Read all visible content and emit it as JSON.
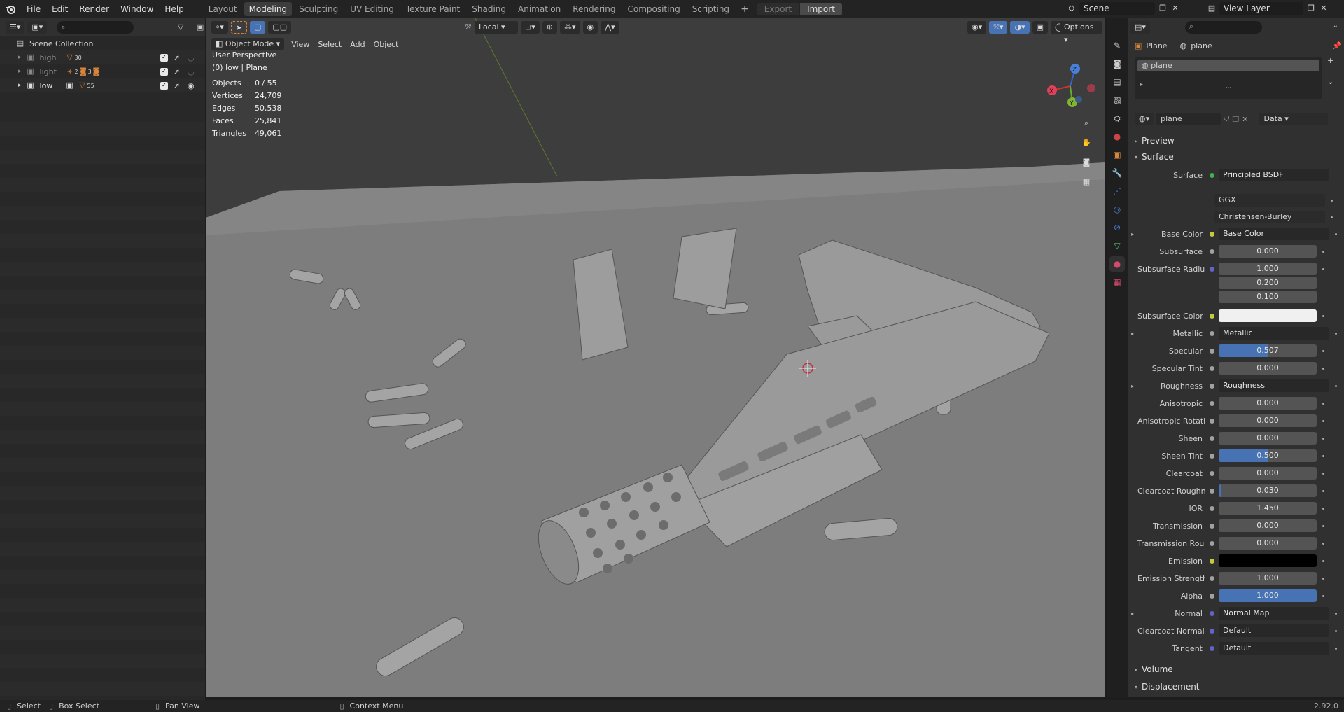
{
  "menu": [
    "File",
    "Edit",
    "Render",
    "Window",
    "Help"
  ],
  "workspaces": [
    "Layout",
    "Modeling",
    "Sculpting",
    "UV Editing",
    "Texture Paint",
    "Shading",
    "Animation",
    "Rendering",
    "Compositing",
    "Scripting"
  ],
  "active_workspace": "Modeling",
  "export_label": "Export",
  "import_label": "Import",
  "scene": "Scene",
  "view_layer": "View Layer",
  "outliner": {
    "title": "Scene Collection",
    "items": [
      {
        "name": "high",
        "badge": "30"
      },
      {
        "name": "light",
        "badge": "2",
        "badge2": "3"
      },
      {
        "name": "low",
        "badge": "55"
      }
    ]
  },
  "viewport": {
    "mode": "Object Mode",
    "menus": [
      "View",
      "Select",
      "Add",
      "Object"
    ],
    "orientation": "Local",
    "options": "Options",
    "perspective": "User Perspective",
    "context": "(0) low | Plane",
    "stats": [
      {
        "label": "Objects",
        "value": "0 / 55"
      },
      {
        "label": "Vertices",
        "value": "24,709"
      },
      {
        "label": "Edges",
        "value": "50,538"
      },
      {
        "label": "Faces",
        "value": "25,841"
      },
      {
        "label": "Triangles",
        "value": "49,061"
      }
    ],
    "gizmo": {
      "x": "X",
      "y": "Y",
      "z": "Z"
    }
  },
  "properties": {
    "object": "Plane",
    "material": "plane",
    "slot": "plane",
    "mat_field": "plane",
    "link": "Data",
    "panels": {
      "preview": "Preview",
      "surface": "Surface",
      "volume": "Volume",
      "displacement": "Displacement"
    },
    "surface_label": "Surface",
    "surface_value": "Principled BSDF",
    "distribution": "GGX",
    "subsurface_method": "Christensen-Burley",
    "rows": [
      {
        "label": "Base Color",
        "value": "Base Color",
        "kind": "link",
        "sock": "#c8c83a",
        "expand": true
      },
      {
        "label": "Subsurface",
        "value": "0.000",
        "kind": "num",
        "sock": "#a1a1a1"
      },
      {
        "label": "Subsurface Radius",
        "value": "1.000",
        "kind": "num",
        "sock": "#6363c7"
      },
      {
        "label": "",
        "value": "0.200",
        "kind": "num",
        "sock": ""
      },
      {
        "label": "",
        "value": "0.100",
        "kind": "num",
        "sock": ""
      },
      {
        "label": "Subsurface Color",
        "value": "",
        "kind": "color",
        "color": "#f0f0f0",
        "sock": "#c8c83a"
      },
      {
        "label": "Metallic",
        "value": "Metallic",
        "kind": "link",
        "sock": "#a1a1a1",
        "expand": true
      },
      {
        "label": "Specular",
        "value": "0.507",
        "kind": "slider",
        "fill": 0.507,
        "sock": "#a1a1a1"
      },
      {
        "label": "Specular Tint",
        "value": "0.000",
        "kind": "num",
        "sock": "#a1a1a1"
      },
      {
        "label": "Roughness",
        "value": "Roughness",
        "kind": "link",
        "sock": "#a1a1a1",
        "expand": true
      },
      {
        "label": "Anisotropic",
        "value": "0.000",
        "kind": "num",
        "sock": "#a1a1a1"
      },
      {
        "label": "Anisotropic Rotation",
        "value": "0.000",
        "kind": "num",
        "sock": "#a1a1a1"
      },
      {
        "label": "Sheen",
        "value": "0.000",
        "kind": "num",
        "sock": "#a1a1a1"
      },
      {
        "label": "Sheen Tint",
        "value": "0.500",
        "kind": "slider",
        "fill": 0.5,
        "sock": "#a1a1a1"
      },
      {
        "label": "Clearcoat",
        "value": "0.000",
        "kind": "num",
        "sock": "#a1a1a1"
      },
      {
        "label": "Clearcoat Roughness",
        "value": "0.030",
        "kind": "slider",
        "fill": 0.03,
        "sock": "#a1a1a1"
      },
      {
        "label": "IOR",
        "value": "1.450",
        "kind": "num",
        "sock": "#a1a1a1"
      },
      {
        "label": "Transmission",
        "value": "0.000",
        "kind": "num",
        "sock": "#a1a1a1"
      },
      {
        "label": "Transmission Rough...",
        "value": "0.000",
        "kind": "num",
        "sock": "#a1a1a1"
      },
      {
        "label": "Emission",
        "value": "",
        "kind": "color",
        "color": "#000000",
        "sock": "#c8c83a"
      },
      {
        "label": "Emission Strength",
        "value": "1.000",
        "kind": "num",
        "sock": "#a1a1a1"
      },
      {
        "label": "Alpha",
        "value": "1.000",
        "kind": "slider",
        "fill": 1.0,
        "sock": "#a1a1a1"
      },
      {
        "label": "Normal",
        "value": "Normal Map",
        "kind": "link",
        "sock": "#6363c7",
        "expand": true
      },
      {
        "label": "Clearcoat Normal",
        "value": "Default",
        "kind": "link",
        "sock": "#6363c7"
      },
      {
        "label": "Tangent",
        "value": "Default",
        "kind": "link",
        "sock": "#6363c7"
      }
    ]
  },
  "status": {
    "select": "Select",
    "box_select": "Box Select",
    "pan_view": "Pan View",
    "context_menu": "Context Menu",
    "version": "2.92.0"
  },
  "colors": {
    "accent": "#4772b3",
    "active_tab": "#3d3d3d",
    "viewport_bg": "#3d3d3d"
  }
}
